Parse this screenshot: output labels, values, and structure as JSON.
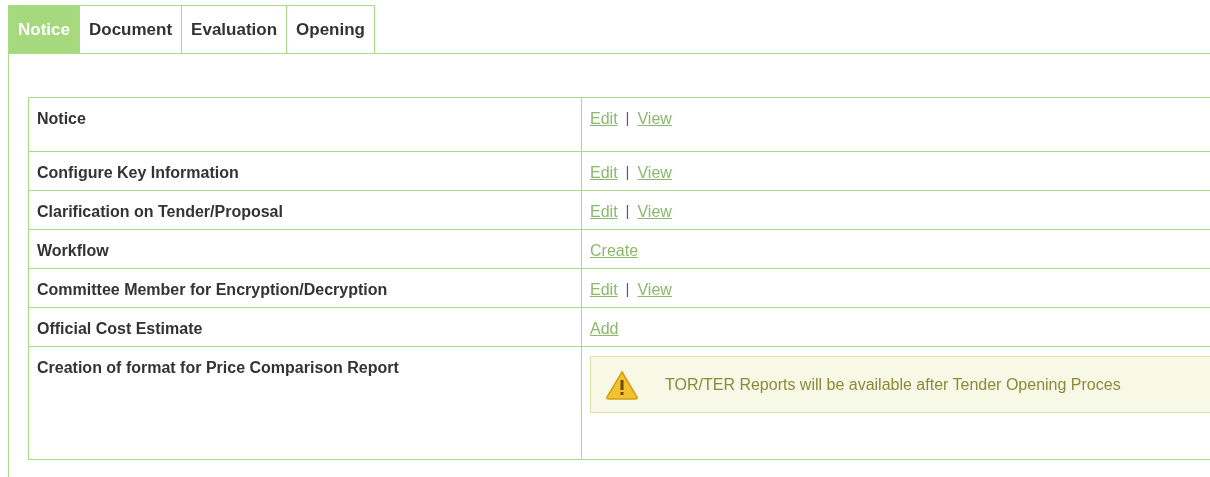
{
  "tabs": [
    {
      "label": "Notice",
      "selected": true
    },
    {
      "label": "Document",
      "selected": false
    },
    {
      "label": "Evaluation",
      "selected": false
    },
    {
      "label": "Opening",
      "selected": false
    }
  ],
  "rows": [
    {
      "label": "Notice",
      "actions": [
        {
          "kind": "link",
          "text": "Edit"
        },
        {
          "kind": "separator",
          "text": "|"
        },
        {
          "kind": "link",
          "text": "View"
        }
      ]
    },
    {
      "label": "Configure Key Information",
      "actions": [
        {
          "kind": "link",
          "text": "Edit"
        },
        {
          "kind": "separator",
          "text": "|"
        },
        {
          "kind": "link",
          "text": "View"
        }
      ]
    },
    {
      "label": "Clarification on Tender/Proposal",
      "actions": [
        {
          "kind": "link",
          "text": "Edit"
        },
        {
          "kind": "separator",
          "text": "|"
        },
        {
          "kind": "link",
          "text": "View"
        }
      ]
    },
    {
      "label": "Workflow",
      "actions": [
        {
          "kind": "link",
          "text": "Create"
        }
      ]
    },
    {
      "label": "Committee Member for Encryption/Decryption",
      "actions": [
        {
          "kind": "link",
          "text": "Edit"
        },
        {
          "kind": "separator",
          "text": "|"
        },
        {
          "kind": "link",
          "text": "View"
        }
      ]
    },
    {
      "label": "Official Cost Estimate",
      "actions": [
        {
          "kind": "link",
          "text": "Add"
        }
      ]
    },
    {
      "label": "Creation of format for Price Comparison Report",
      "actions": [
        {
          "kind": "notice",
          "text": "TOR/TER Reports will be available after Tender Opening Proces"
        }
      ]
    }
  ]
}
